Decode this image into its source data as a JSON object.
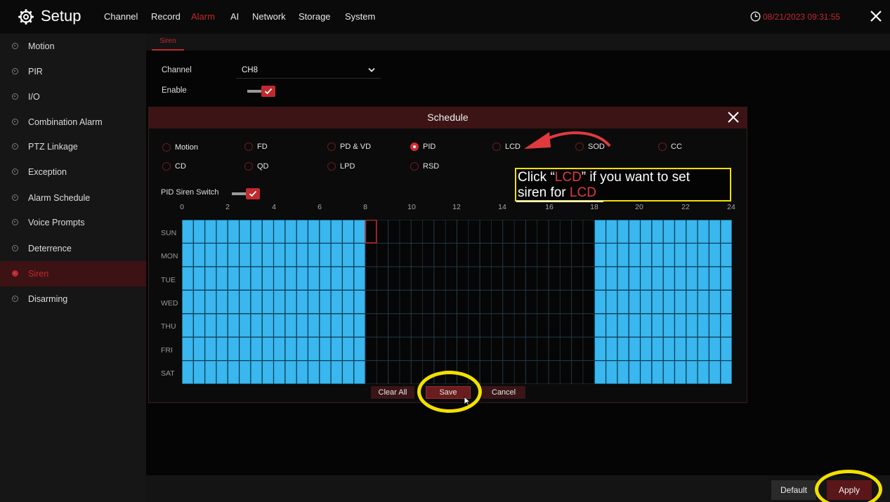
{
  "header": {
    "title": "Setup",
    "nav": [
      "Channel",
      "Record",
      "Alarm",
      "AI",
      "Network",
      "Storage",
      "System"
    ],
    "active_nav": "Alarm",
    "datetime": "08/21/2023 09:31:55"
  },
  "sidebar": {
    "items": [
      {
        "label": "Motion"
      },
      {
        "label": "PIR"
      },
      {
        "label": "I/O"
      },
      {
        "label": "Combination Alarm"
      },
      {
        "label": "PTZ Linkage"
      },
      {
        "label": "Exception"
      },
      {
        "label": "Alarm Schedule"
      },
      {
        "label": "Voice Prompts"
      },
      {
        "label": "Deterrence"
      },
      {
        "label": "Siren"
      },
      {
        "label": "Disarming"
      }
    ],
    "active": "Siren"
  },
  "subtab": {
    "label": "Siren"
  },
  "form": {
    "channel_label": "Channel",
    "channel_value": "CH8",
    "enable_label": "Enable",
    "enable_on": true
  },
  "modal": {
    "title": "Schedule",
    "radios": [
      {
        "label": "Motion",
        "selected": false
      },
      {
        "label": "FD",
        "selected": false
      },
      {
        "label": "PD & VD",
        "selected": false
      },
      {
        "label": "PID",
        "selected": true
      },
      {
        "label": "LCD",
        "selected": false
      },
      {
        "label": "SOD",
        "selected": false
      },
      {
        "label": "CC",
        "selected": false
      },
      {
        "label": "CD",
        "selected": false
      },
      {
        "label": "QD",
        "selected": false
      },
      {
        "label": "LPD",
        "selected": false
      },
      {
        "label": "RSD",
        "selected": false
      }
    ],
    "switch_label": "PID Siren Switch",
    "switch_on": true,
    "hours": [
      "0",
      "2",
      "4",
      "6",
      "8",
      "10",
      "12",
      "14",
      "16",
      "18",
      "20",
      "22",
      "24"
    ],
    "days": [
      "SUN",
      "MON",
      "TUE",
      "WED",
      "THU",
      "FRI",
      "SAT"
    ],
    "schedule_ranges": [
      [
        0,
        8
      ],
      [
        18,
        24
      ]
    ],
    "buttons": {
      "clear_all": "Clear All",
      "save": "Save",
      "cancel": "Cancel"
    }
  },
  "footer": {
    "default_label": "Default",
    "apply_label": "Apply"
  },
  "annotation": {
    "pre": "Click “",
    "highlight": "LCD",
    "post": "” if you want to set",
    "line2_pre": "siren for ",
    "line2_highlight": "LCD"
  },
  "colors": {
    "accent": "#c0292e",
    "schedule_fill": "#39b7ee",
    "annotation_yellow": "#f3e000"
  }
}
